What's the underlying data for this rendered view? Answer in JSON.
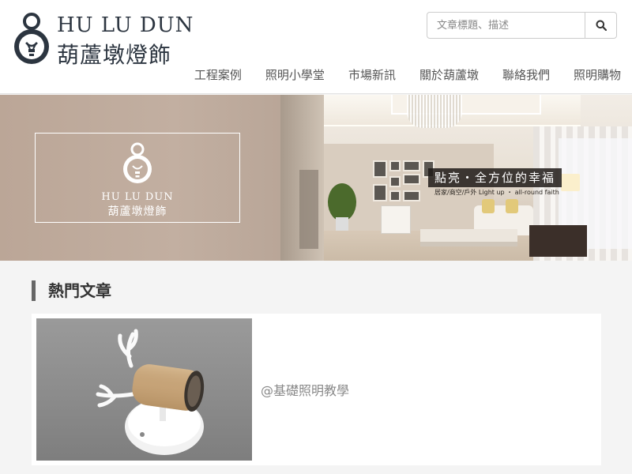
{
  "brand": {
    "name_en": "HU LU DUN",
    "name_zh": "葫蘆墩燈飾"
  },
  "search": {
    "placeholder": "文章標題、描述"
  },
  "nav": {
    "items": [
      {
        "label": "工程案例"
      },
      {
        "label": "照明小學堂"
      },
      {
        "label": "市場新訊"
      },
      {
        "label": "關於葫蘆墩"
      },
      {
        "label": "聯絡我們"
      },
      {
        "label": "照明購物"
      }
    ]
  },
  "banner": {
    "logo_en": "HU LU DUN",
    "logo_zh": "葫蘆墩燈飾",
    "tagline": "點亮・全方位的幸福",
    "tagline_sub": "居家/商空/戶外  Light up ・ all-round faith"
  },
  "popular": {
    "title": "熱門文章",
    "articles": [
      {
        "title": "@基礎照明教學"
      }
    ]
  },
  "colors": {
    "brand_dark": "#2c3540",
    "banner_tan": "#c2afa1",
    "wood": "#c9a77c"
  }
}
